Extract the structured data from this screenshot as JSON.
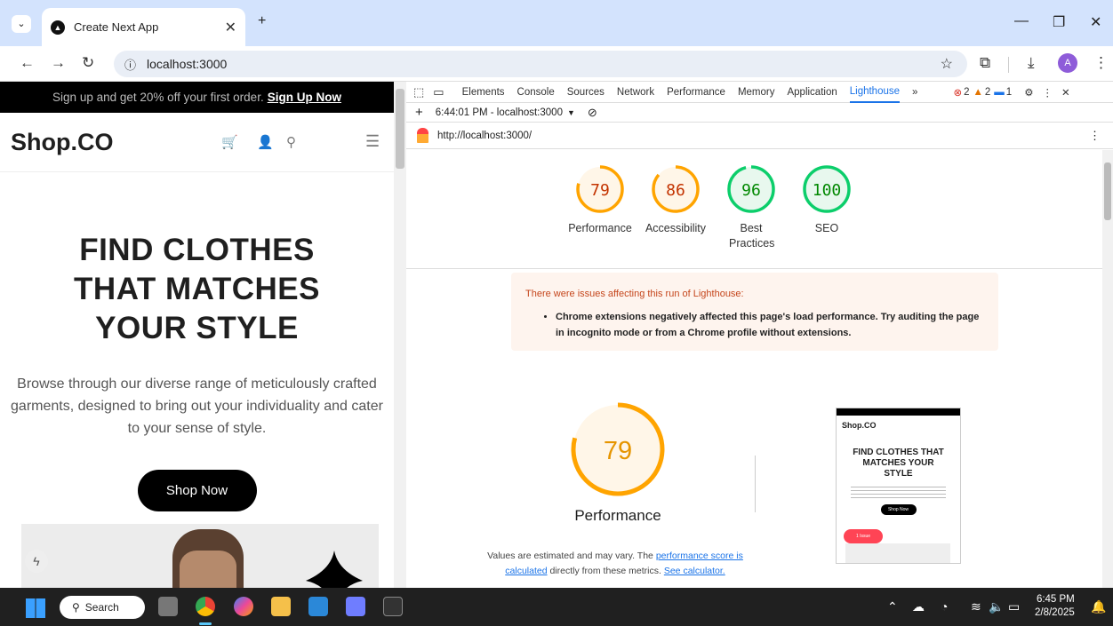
{
  "browser": {
    "tab_title": "Create Next App",
    "url": "localhost:3000",
    "avatar": "A"
  },
  "page": {
    "promo_text": "Sign up and get 20% off your first order.",
    "promo_link": "Sign Up Now",
    "logo": "Shop.CO",
    "hero_line1": "FIND CLOTHES",
    "hero_line2": "THAT MATCHES",
    "hero_line3": "YOUR STYLE",
    "description": "Browse through our diverse range of meticulously crafted garments, designed to bring out your individuality and cater to your sense of style.",
    "cta": "Shop Now"
  },
  "devtools": {
    "tabs": [
      "Elements",
      "Console",
      "Sources",
      "Network",
      "Performance",
      "Memory",
      "Application",
      "Lighthouse"
    ],
    "active_tab": "Lighthouse",
    "errors": "2",
    "warnings": "2",
    "messages": "1",
    "report_select": "6:44:01 PM - localhost:3000",
    "report_url": "http://localhost:3000/"
  },
  "lighthouse": {
    "scores": [
      {
        "label": "Performance",
        "value": 79,
        "color": "#fa3"
      },
      {
        "label": "Accessibility",
        "value": 86,
        "color": "#fa3"
      },
      {
        "label": "Best Practices",
        "value": 96,
        "color": "#0c6"
      },
      {
        "label": "SEO",
        "value": 100,
        "color": "#0c6"
      }
    ],
    "warning_head": "There were issues affecting this run of Lighthouse:",
    "warning_item": "Chrome extensions negatively affected this page's load performance. Try auditing the page in incognito mode or from a Chrome profile without extensions.",
    "perf_score": "79",
    "perf_title": "Performance",
    "perf_note_1": "Values are estimated and may vary. The",
    "perf_link_1": "performance score is calculated",
    "perf_note_2": "directly from these metrics.",
    "perf_link_2": "See calculator."
  },
  "thumbnail": {
    "logo": "Shop.CO",
    "hero": "FIND CLOTHES THAT MATCHES YOUR STYLE",
    "cta": "Shop Now",
    "issue_badge": "1 Issue"
  },
  "taskbar": {
    "search": "Search",
    "time": "6:45 PM",
    "date": "2/8/2025"
  },
  "colors": {
    "orange": "#ffa400",
    "green": "#0cce6b",
    "accent": "#1a73e8"
  }
}
